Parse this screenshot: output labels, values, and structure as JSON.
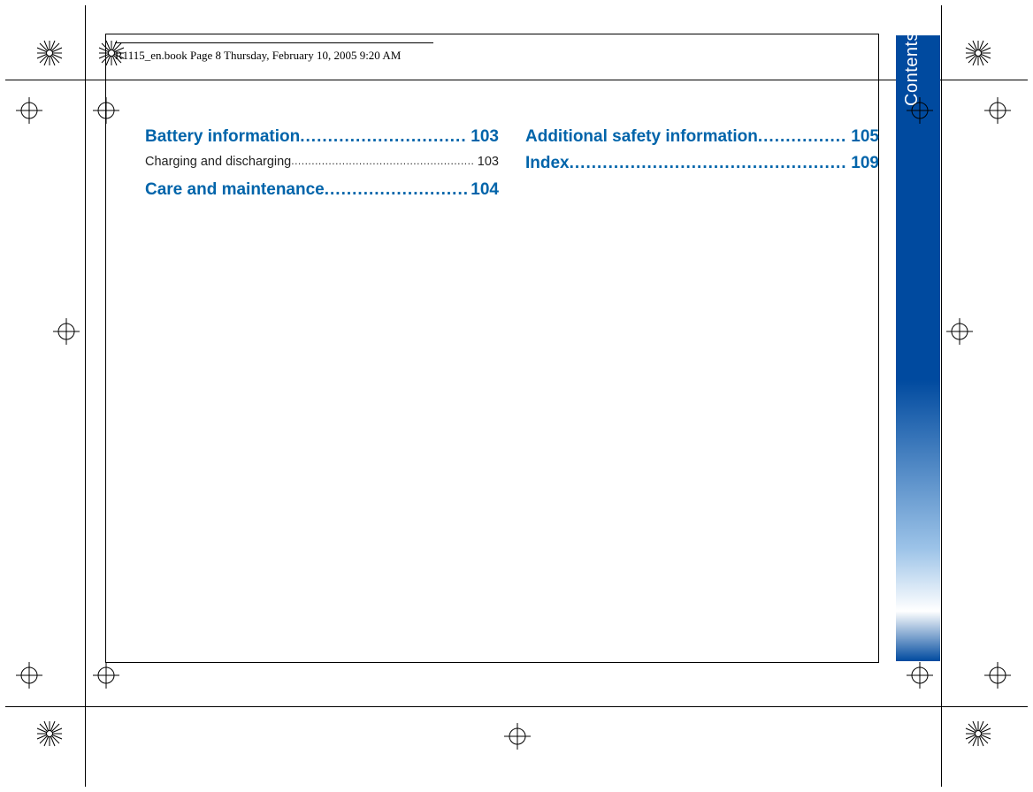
{
  "header": "R1115_en.book  Page 8  Thursday, February 10, 2005  9:20 AM",
  "tab_label": "Contents",
  "left_column": [
    {
      "level": 1,
      "label": "Battery information",
      "page": "103"
    },
    {
      "level": 2,
      "label": "Charging and discharging",
      "page": "103"
    },
    {
      "level": 1,
      "label": "Care and maintenance",
      "page": "104"
    }
  ],
  "right_column": [
    {
      "level": 1,
      "label": "Additional safety information",
      "page": "105"
    },
    {
      "level": 1,
      "label": "Index",
      "page": "109"
    }
  ]
}
